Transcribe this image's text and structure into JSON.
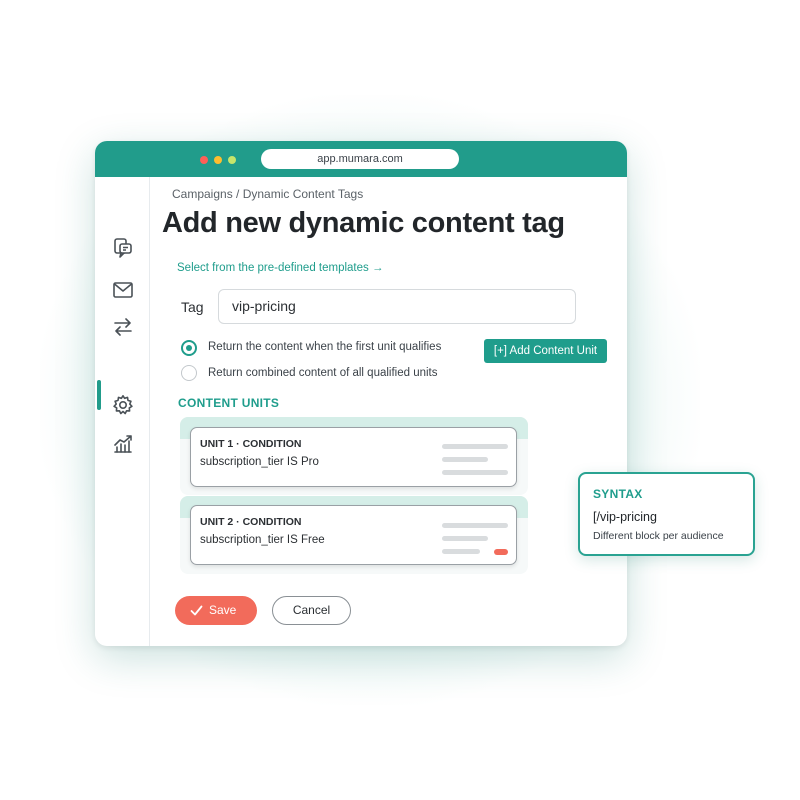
{
  "browser": {
    "url": "app.mumara.com"
  },
  "sidebar": {
    "icons": [
      "chat-icon",
      "mail-icon",
      "swap-arrows-icon",
      "gear-icon",
      "chart-icon"
    ],
    "active_index": 3
  },
  "page": {
    "breadcrumb": "Campaigns / Dynamic Content Tags",
    "title": "Add new dynamic content tag",
    "template_link": "Select from the pre-defined templates →"
  },
  "form": {
    "tag_label": "Tag",
    "tag_value": "vip-pricing",
    "radio_options": [
      {
        "label": "Return the content when the first unit qualifies",
        "selected": true
      },
      {
        "label": "Return combined content of all qualified units",
        "selected": false
      }
    ],
    "add_unit_label": "[+] Add Content Unit",
    "units_heading": "CONTENT UNITS",
    "units": [
      {
        "title": "UNIT 1 · CONDITION",
        "condition": "subscription_tier  IS Pro"
      },
      {
        "title": "UNIT 2 · CONDITION",
        "condition": "subscription_tier  IS Free"
      }
    ],
    "save_label": "Save",
    "cancel_label": "Cancel"
  },
  "syntax": {
    "title": "SYNTAX",
    "code": "[/vip-pricing",
    "description": "Different block per audience"
  },
  "colors": {
    "accent": "#219c8b",
    "save": "#f26b5b"
  }
}
